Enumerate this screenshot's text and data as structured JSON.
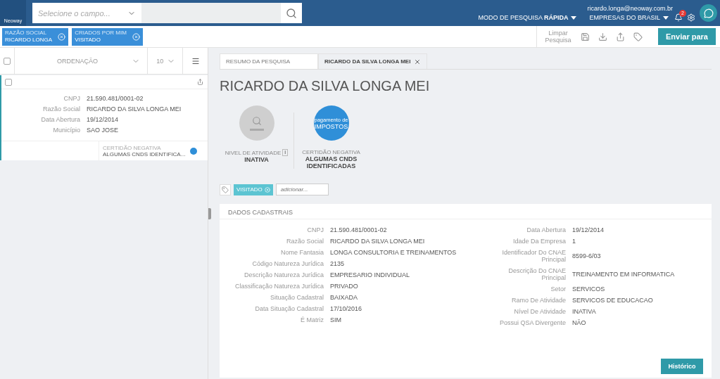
{
  "topbar": {
    "logo_text": "Neoway",
    "field_select": {
      "placeholder": "Selecione o campo..."
    },
    "user_email": "ricardo.longa@neoway.com.br",
    "mode": "MODO DE PESQUISA **RÁPIDA**",
    "database": "EMPRESAS DO BRASIL",
    "notifications": "2"
  },
  "filters": [
    {
      "label": "RAZÃO SOCIAL",
      "value": "RICARDO LONGA"
    },
    {
      "label": "CRIADOS POR MIM",
      "value": "VISITADO"
    }
  ],
  "toolbar": {
    "clear": "Limpar Pesquisa",
    "send": "Enviar para"
  },
  "list": {
    "select_all": {
      "checked": false
    },
    "sort": "ORDENAÇÃO",
    "page_size": "10",
    "results": [
      {
        "checked": false,
        "fields": [
          {
            "label": "CNPJ",
            "value": "21.590.481/0001-02"
          },
          {
            "label": "Razão Social",
            "value": "RICARDO DA SILVA LONGA MEI"
          },
          {
            "label": "Data Abertura",
            "value": "19/12/2014"
          },
          {
            "label": "Município",
            "value": "SAO JOSE"
          }
        ],
        "status_label": "CERTIDÃO NEGATIVA",
        "status_value": "ALGUMAS CNDS IDENTIFICA...",
        "color": "#2f8fd8"
      }
    ]
  },
  "tabs": [
    {
      "label": "RESUMO DA PESQUISA",
      "selected": false,
      "closable": false
    },
    {
      "label": "RICARDO DA SILVA LONGA MEI",
      "selected": true,
      "closable": true
    }
  ],
  "company": {
    "name": "RICARDO DA SILVA LONGA MEI",
    "indicators": [
      {
        "kind": "activity",
        "label": "NIVEL DE ATIVIDADE",
        "value": "INATIVA",
        "info": "i"
      },
      {
        "kind": "tax",
        "badge_small": "pagamento de",
        "badge_big": "IMPOSTOS",
        "label": "CERTIDÃO NEGATIVA",
        "value": "ALGUMAS CNDS IDENTIFICADAS"
      }
    ],
    "tags": [
      "VISITADO"
    ],
    "tag_input": {
      "placeholder": "adicionar..."
    }
  },
  "details": {
    "title": "DADOS CADASTRAIS",
    "left": [
      {
        "label": "CNPJ",
        "value": "21.590.481/0001-02"
      },
      {
        "label": "Razão Social",
        "value": "RICARDO DA SILVA LONGA MEI"
      },
      {
        "label": "Nome Fantasia",
        "value": "LONGA CONSULTORIA E TREINAMENTOS"
      },
      {
        "label": "Código Natureza Jurídica",
        "value": "2135"
      },
      {
        "label": "Descrição Natureza Jurídica",
        "value": "EMPRESARIO INDIVIDUAL"
      },
      {
        "label": "Classificação Natureza Jurídica",
        "value": "PRIVADO"
      },
      {
        "label": "Situação Cadastral",
        "value": "BAIXADA"
      },
      {
        "label": "Data Situação Cadastral",
        "value": "17/10/2016"
      },
      {
        "label": "É Matriz",
        "value": "SIM"
      }
    ],
    "right": [
      {
        "label": "Data Abertura",
        "value": "19/12/2014"
      },
      {
        "label": "Idade Da Empresa",
        "value": "1"
      },
      {
        "label": "Identificador Do CNAE Principal",
        "value": "8599-6/03"
      },
      {
        "label": "Descrição Do CNAE Principal",
        "value": "TREINAMENTO EM INFORMATICA"
      },
      {
        "label": "Setor",
        "value": "SERVICOS"
      },
      {
        "label": "Ramo De Atividade",
        "value": "SERVICOS DE EDUCACAO"
      },
      {
        "label": "Nível De Atividade",
        "value": "INATIVA"
      },
      {
        "label": "Possui QSA Divergente",
        "value": "NÃO"
      }
    ],
    "history_button": "Histórico"
  }
}
